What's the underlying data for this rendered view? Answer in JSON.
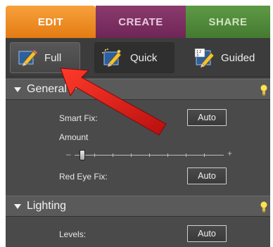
{
  "mode_tabs": {
    "edit": "EDIT",
    "create": "CREATE",
    "share": "SHARE"
  },
  "edit_modes": {
    "full": "Full",
    "quick": "Quick",
    "guided": "Guided"
  },
  "sections": {
    "general": {
      "title": "General F",
      "smart_fix_label": "Smart Fix:",
      "smart_fix_button": "Auto",
      "amount_label": "Amount",
      "slider_minus": "–",
      "slider_plus": "+",
      "red_eye_label": "Red Eye Fix:",
      "red_eye_button": "Auto"
    },
    "lighting": {
      "title": "Lighting",
      "levels_label": "Levels:",
      "levels_button": "Auto"
    }
  },
  "slider_amount": 0.05,
  "colors": {
    "edit_tab": "#e47b12",
    "create_tab": "#6e2656",
    "share_tab": "#457a31",
    "panel": "#4a4a4a",
    "callout_arrow": "#d81e1e"
  }
}
